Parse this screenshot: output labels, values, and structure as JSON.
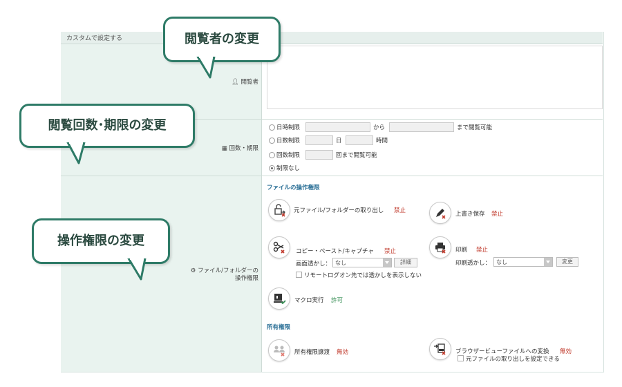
{
  "header": {
    "title": "カスタムで設定する"
  },
  "callouts": {
    "viewer": "閲覧者の変更",
    "count_period": "閲覧回数･期限の変更",
    "permissions": "操作権限の変更"
  },
  "viewer": {
    "label": "閲覧者",
    "icon": "user-icon"
  },
  "limits": {
    "label": "回数・期限",
    "icon": "calendar-icon",
    "options": [
      {
        "label": "日時制限",
        "from": "から",
        "until": "まで閲覧可能",
        "selected": false
      },
      {
        "label": "日数制限",
        "unit_day": "日",
        "unit_hour": "時間",
        "selected": false
      },
      {
        "label": "回数制限",
        "suffix": "回まで閲覧可能",
        "selected": false
      },
      {
        "label": "制限なし",
        "selected": true
      }
    ]
  },
  "permissions": {
    "label_line1": "ファイル/フォルダーの",
    "label_line2": "操作権限",
    "icon": "gear-icon",
    "file_section": "ファイルの操作権限",
    "extract": {
      "label": "元ファイル/フォルダーの取り出し",
      "status": "禁止"
    },
    "overwrite": {
      "label": "上書き保存",
      "status": "禁止"
    },
    "copy": {
      "label": "コピー・ペースト/キャプチャ",
      "status": "禁止"
    },
    "screen_watermark": {
      "label": "画面透かし：",
      "value": "なし",
      "button": "詳細"
    },
    "remote_checkbox": "リモートログオン先では透かしを表示しない",
    "print": {
      "label": "印刷",
      "status": "禁止"
    },
    "print_watermark": {
      "label": "印刷透かし：",
      "value": "なし",
      "button": "変更"
    },
    "macro": {
      "label": "マクロ実行",
      "status": "許可"
    },
    "owner_section": "所有権限",
    "transfer": {
      "label": "所有権限譲渡",
      "status": "無効"
    },
    "convert": {
      "label": "ブラウザービューファイルへの変換",
      "status": "無効"
    },
    "convert_checkbox": "元ファイルの取り出しを設定できる"
  },
  "colors": {
    "accent": "#2e7b67",
    "deny": "#c0392b",
    "allow": "#2f8a4e",
    "section": "#2a6f96",
    "leftcol": "#e9f3ef"
  }
}
